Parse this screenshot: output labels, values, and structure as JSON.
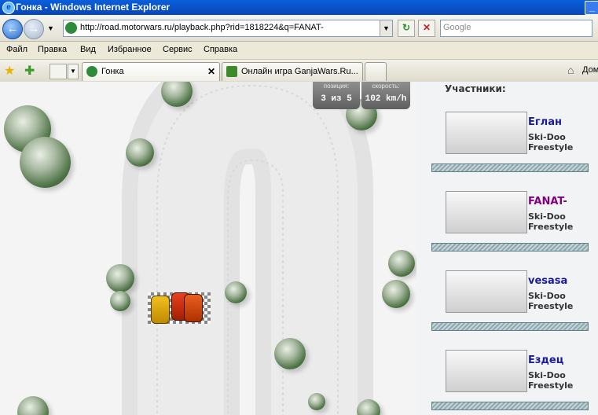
{
  "window": {
    "title": "Гонка - Windows Internet Explorer"
  },
  "address": {
    "url": "http://road.motorwars.ru/playback.php?rid=1818224&q=FANAT-"
  },
  "search": {
    "placeholder": "Google"
  },
  "menu": {
    "items": [
      "Файл",
      "Правка",
      "Вид",
      "Избранное",
      "Сервис",
      "Справка"
    ]
  },
  "tabs": [
    {
      "label": "Гонка"
    },
    {
      "label": "Онлайн игра GanjaWars.Ru..."
    }
  ],
  "home": {
    "label": "Дом"
  },
  "hud": {
    "position_caption": "позиция:",
    "position_value": "3 из 5",
    "speed_caption": "скорость:",
    "speed_value": "102 km/h"
  },
  "panel": {
    "heading": "Участники:",
    "racers": [
      {
        "name": "Еглан",
        "model_line1": "Ski-Doo",
        "model_line2": "Freestyle",
        "name_color": "#1a1aa0"
      },
      {
        "name": "FANAT-",
        "model_line1": "Ski-Doo",
        "model_line2": "Freestyle",
        "name_color": "#800080"
      },
      {
        "name": "vesasa",
        "model_line1": "Ski-Doo",
        "model_line2": "Freestyle",
        "name_color": "#1a1aa0"
      },
      {
        "name": "Ездец",
        "model_line1": "Ski-Doo",
        "model_line2": "Freestyle",
        "name_color": "#1a1aa0"
      }
    ]
  },
  "colors": {
    "titlebar": "#0846b8",
    "panel_bg": "#f2f3f4",
    "hud": "#6f6f6f"
  }
}
